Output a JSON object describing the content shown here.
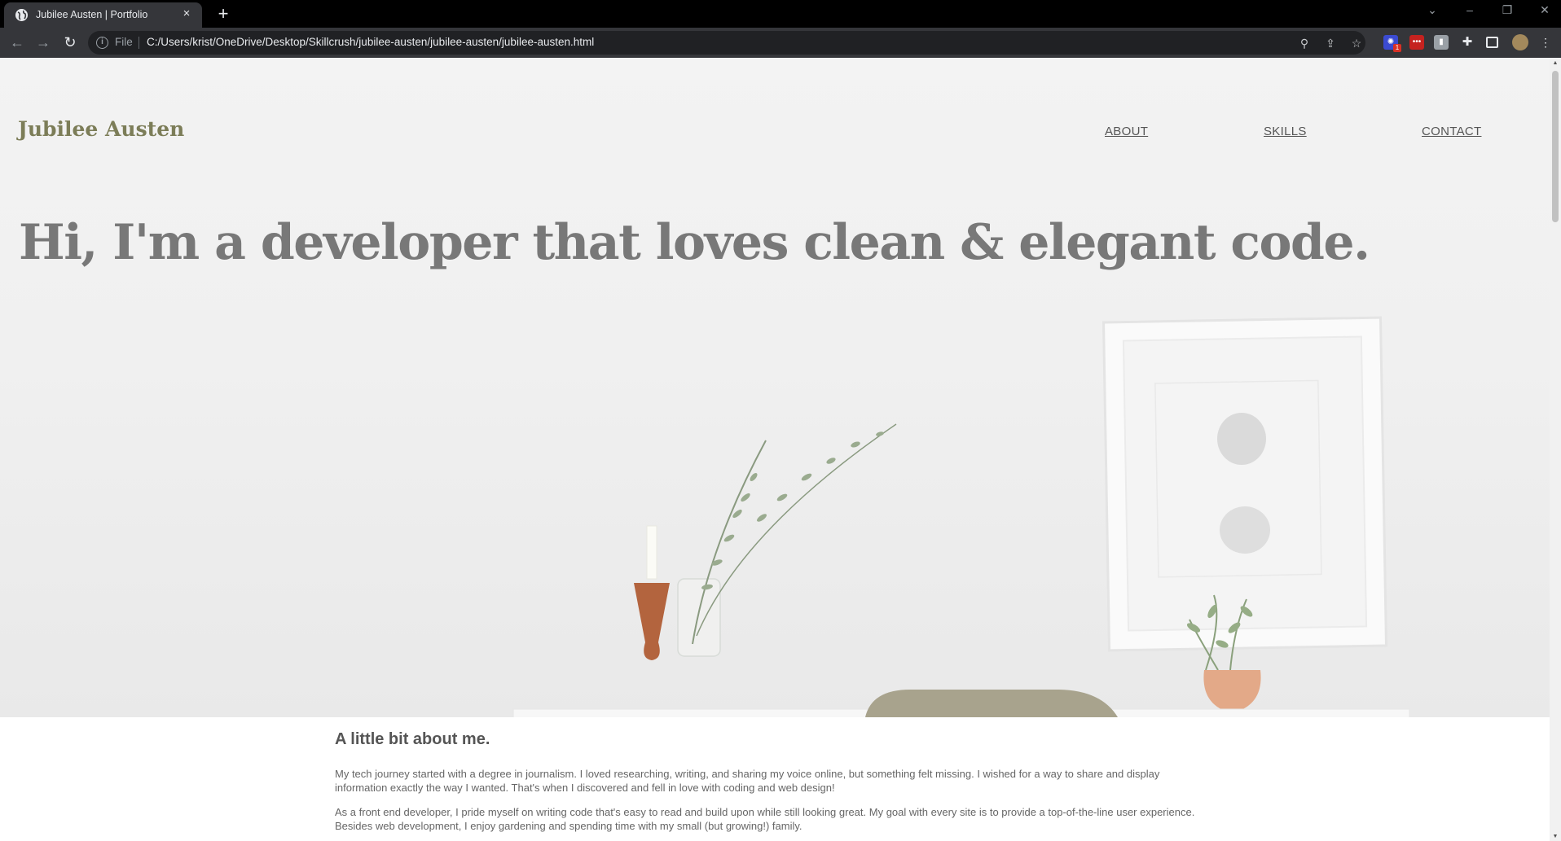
{
  "browser": {
    "tab_title": "Jubilee Austen | Portfolio",
    "tab_close": "×",
    "new_tab": "+",
    "scheme_label": "File",
    "url": "C:/Users/krist/OneDrive/Desktop/Skillcrush/jubilee-austen/jubilee-austen/jubilee-austen.html",
    "extension_badge": "1"
  },
  "site": {
    "logo": "Jubilee Austen",
    "nav": [
      "ABOUT",
      "SKILLS",
      "CONTACT"
    ],
    "headline": "Hi, I'm a developer that loves clean & elegant code."
  },
  "about": {
    "heading": "A little bit about me.",
    "paragraphs": [
      "My tech journey started with a degree in journalism. I loved researching, writing, and sharing my voice online, but something felt missing. I wished for a way to share and display information exactly the way I wanted. That's when I discovered and fell in love with coding and web design!",
      "As a front end developer, I pride myself on writing code that's easy to read and build upon while still looking great. My goal with every site is to provide a top-of-the-line user experience. Besides web development, I enjoy gardening and spending time with my small (but growing!) family."
    ]
  }
}
